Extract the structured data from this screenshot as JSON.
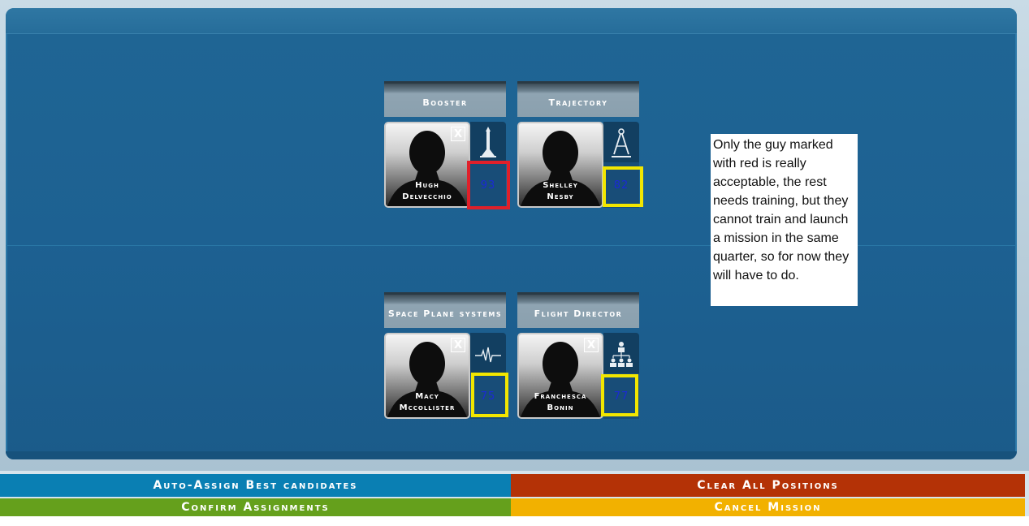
{
  "positions": [
    {
      "title": "Booster",
      "candidate": {
        "first": "Hugh",
        "last": "Delvecchio"
      },
      "score": "93",
      "icon": "rocket-icon",
      "highlight": "#e0202a"
    },
    {
      "title": "Trajectory",
      "candidate": {
        "first": "Shelley",
        "last": "Nesby"
      },
      "score": "82",
      "icon": "compass-icon",
      "highlight": "#f2e600"
    },
    {
      "title": "Space Plane systems",
      "candidate": {
        "first": "Macy",
        "last": "Mccollister"
      },
      "score": "75",
      "icon": "heartbeat-icon",
      "highlight": "#f2e600"
    },
    {
      "title": "Flight Director",
      "candidate": {
        "first": "Franchesca",
        "last": "Bonin"
      },
      "score": "77",
      "icon": "team-hierarchy-icon",
      "highlight": "#f2e600"
    }
  ],
  "close_label": "X",
  "note": "Only the guy marked with red is really acceptable, the rest needs training, but they cannot train and launch a mission in the same quarter, so for now they will have to do.",
  "buttons": {
    "auto_assign": "Auto-Assign Best candidates",
    "clear_all": "Clear All Positions",
    "confirm": "Confirm Assignments",
    "cancel": "Cancel Mission"
  },
  "colors": {
    "panel": "#1d6192",
    "auto_assign": "#0a7fb3",
    "clear_all": "#b43206",
    "confirm": "#65a01c",
    "cancel": "#f2b100",
    "score_text": "#1a2ad6"
  }
}
